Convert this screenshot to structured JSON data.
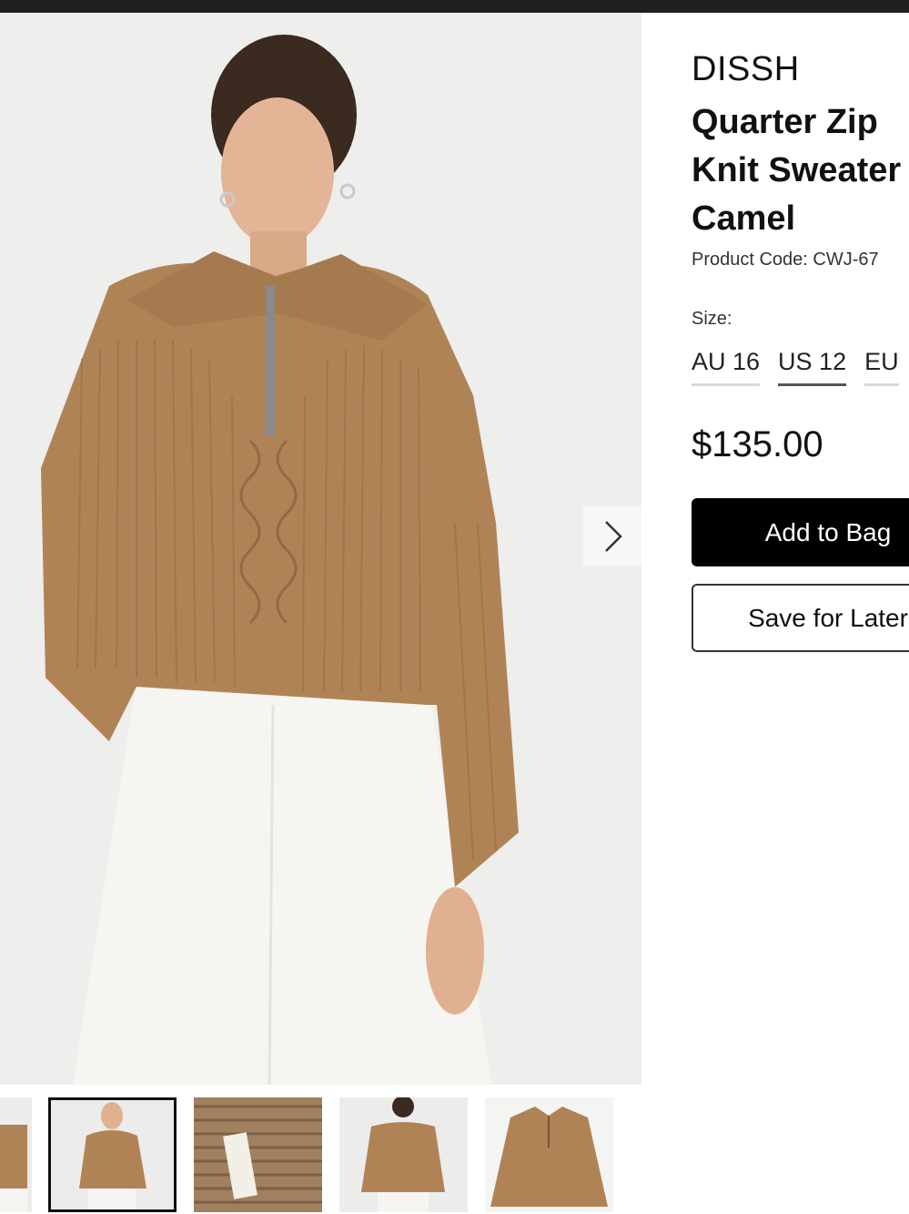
{
  "product": {
    "brand": "DISSH",
    "title_lines": [
      "Quarter Zip",
      "Knit Sweater",
      "Camel"
    ],
    "product_code": "Product Code: CWJ-67",
    "size_label": "Size:",
    "sizes": [
      "AU 16",
      "US 12",
      "EU"
    ],
    "selected_size": "US 12",
    "price": "$135.00",
    "add_label": "Add to Bag",
    "save_label": "Save for Later"
  },
  "gallery": {
    "next_icon": "chevron-right-icon",
    "thumbnails": [
      "model-front",
      "model-front-selected",
      "fabric-detail-label",
      "model-back",
      "flat-lay"
    ],
    "selected_index": 1
  },
  "colors": {
    "camel": "#b08357",
    "trousers": "#f6f5f2",
    "button_black": "#000000"
  }
}
